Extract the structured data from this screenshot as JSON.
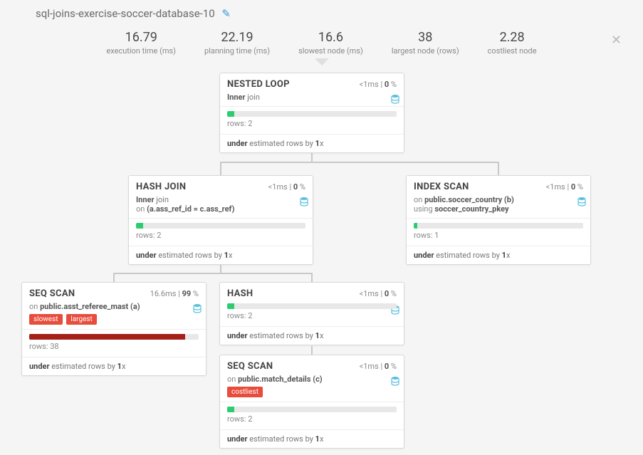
{
  "title": "sql-joins-exercise-soccer-database-10",
  "stats": {
    "exec_time": {
      "val": "16.79",
      "lbl": "execution time (ms)"
    },
    "plan_time": {
      "val": "22.19",
      "lbl": "planning time (ms)"
    },
    "slowest": {
      "val": "16.6",
      "lbl": "slowest node (ms)"
    },
    "largest": {
      "val": "38",
      "lbl": "largest node (rows)"
    },
    "costliest": {
      "val": "2.28",
      "lbl": "costliest node"
    }
  },
  "labels": {
    "under": "under",
    "est_suffix": " estimated rows by ",
    "one_x": "1",
    "x": "x",
    "rows": "rows: ",
    "pipe": " | ",
    "on": "on ",
    "using": "using ",
    "join": " join",
    "lt1ms": "<1ms",
    "pct": " %"
  },
  "nodes": {
    "nested_loop": {
      "name": "NESTED LOOP",
      "time": "<1",
      "pct": "0",
      "join_type": "Inner",
      "rows": "2",
      "fill": "4"
    },
    "hash_join": {
      "name": "HASH JOIN",
      "time": "<1",
      "pct": "0",
      "join_type": "Inner",
      "cond": "(a.ass_ref_id = c.ass_ref)",
      "rows": "2",
      "fill": "4"
    },
    "index_scan": {
      "name": "INDEX SCAN",
      "time": "<1",
      "pct": "0",
      "target": "public.soccer_country (b)",
      "index": "soccer_country_pkey",
      "rows": "1",
      "fill": "2"
    },
    "seq_scan_a": {
      "name": "SEQ SCAN",
      "time_ms": "16.6ms",
      "pct": "99",
      "target": "public.asst_referee_mast (a)",
      "tags": [
        "slowest",
        "largest"
      ],
      "rows": "38",
      "fill": "92",
      "fill_color": "red"
    },
    "hash": {
      "name": "HASH",
      "time": "<1",
      "pct": "0",
      "rows": "2",
      "fill": "4"
    },
    "seq_scan_c": {
      "name": "SEQ SCAN",
      "time": "<1",
      "pct": "0",
      "target": "public.match_details (c)",
      "tags": [
        "costliest"
      ],
      "rows": "2",
      "fill": "4"
    }
  }
}
